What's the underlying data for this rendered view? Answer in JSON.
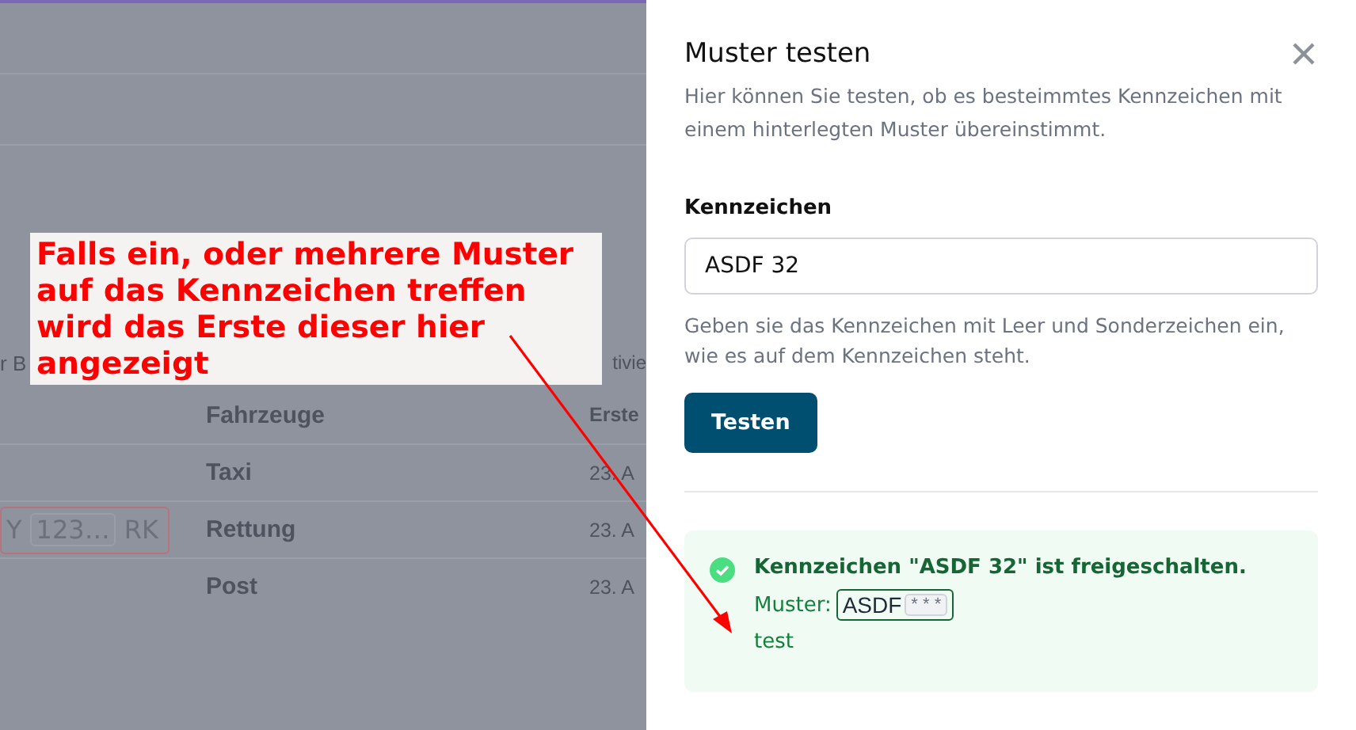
{
  "background_page": {
    "cut_header": [
      "r B",
      "tivie"
    ],
    "table": {
      "columns": [
        "Fahrzeuge",
        "Erste"
      ],
      "rows": [
        {
          "vehicles": "Taxi",
          "first": "23. A"
        },
        {
          "plate": [
            "Y",
            "123…",
            "RK"
          ],
          "vehicles": "Rettung",
          "first": "23. A"
        },
        {
          "vehicles": "Post",
          "first": "23. A"
        }
      ]
    }
  },
  "annotation": {
    "text": "Falls ein, oder mehrere Muster auf das Kennzeichen treffen wird das Erste dieser hier angezeigt"
  },
  "drawer": {
    "title": "Muster testen",
    "description": "Hier können Sie testen, ob es besteimmtes Kennzeichen mit einem hinterlegten Muster übereinstimmt.",
    "field": {
      "label": "Kennzeichen",
      "value": "ASDF 32",
      "hint": "Geben sie das Kennzeichen mit Leer und Sonderzeichen ein, wie es auf dem Kennzeichen steht."
    },
    "button": "Testen",
    "result": {
      "kind": "success",
      "message": "Kennzeichen \"ASDF 32\" ist freigeschalten.",
      "pattern_label": "Muster:",
      "pattern_parts": [
        {
          "kind": "literal",
          "text": "ASDF"
        },
        {
          "kind": "wildcard",
          "text": "* * *"
        }
      ],
      "note": "test"
    }
  }
}
